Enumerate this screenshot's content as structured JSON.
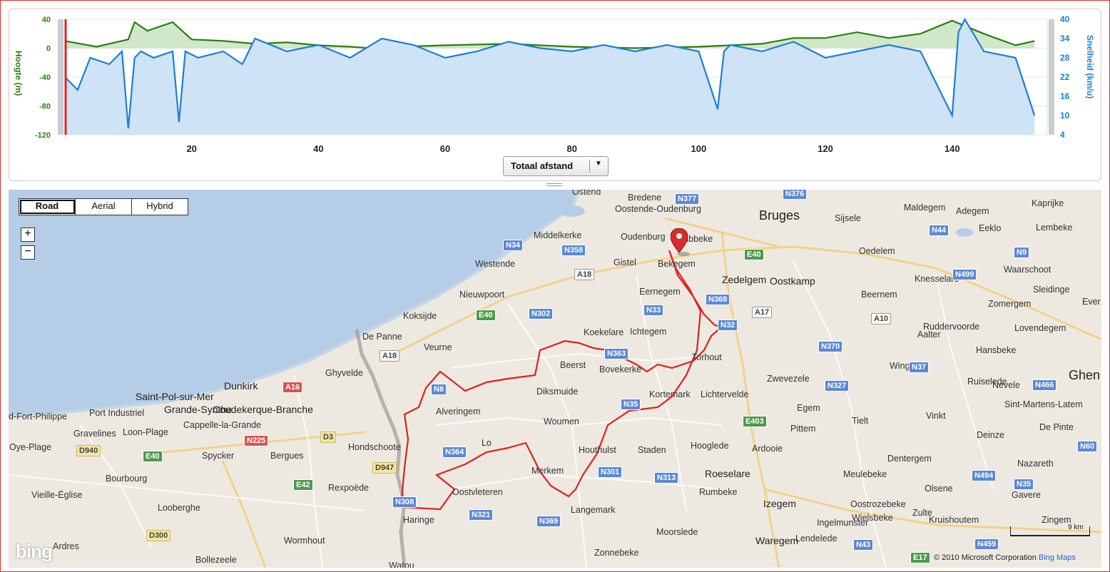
{
  "chart": {
    "left_axis_label": "Hoogte (m)",
    "right_axis_label": "Snelheid (km/u)",
    "left_ticks": [
      "40",
      "0",
      "-40",
      "-80",
      "-120"
    ],
    "right_ticks": [
      "40",
      "34",
      "28",
      "22",
      "16",
      "10",
      "4"
    ],
    "x_ticks": [
      "20",
      "40",
      "60",
      "80",
      "100",
      "120",
      "140"
    ],
    "distance_select": "Totaal afstand",
    "colors": {
      "altitude": "#2e7d10",
      "speed": "#1a7fd8",
      "cursor": "#e02020"
    }
  },
  "chart_data": [
    {
      "type": "area",
      "name": "Hoogte",
      "xlabel": "",
      "ylabel": "Hoogte (m)",
      "xlim": [
        0,
        155
      ],
      "ylim": [
        -120,
        40
      ],
      "x": [
        0,
        5,
        10,
        11,
        13,
        17,
        20,
        25,
        30,
        35,
        40,
        45,
        48,
        49,
        50,
        51,
        53,
        60,
        70,
        80,
        90,
        100,
        110,
        115,
        120,
        125,
        130,
        135,
        140,
        145,
        150,
        153
      ],
      "y": [
        10,
        2,
        12,
        36,
        24,
        36,
        12,
        10,
        6,
        8,
        4,
        2,
        0,
        -80,
        -108,
        -20,
        2,
        4,
        6,
        2,
        0,
        2,
        6,
        14,
        14,
        22,
        14,
        20,
        38,
        20,
        4,
        10
      ]
    },
    {
      "type": "line",
      "name": "Snelheid",
      "xlabel": "",
      "ylabel": "Snelheid (km/u)",
      "xlim": [
        0,
        155
      ],
      "ylim": [
        4,
        40
      ],
      "x": [
        0,
        2,
        4,
        7,
        9,
        10,
        11,
        12,
        14,
        17,
        18,
        19,
        21,
        25,
        28,
        30,
        35,
        40,
        45,
        50,
        55,
        60,
        65,
        70,
        75,
        80,
        85,
        90,
        95,
        100,
        103,
        104,
        105,
        110,
        115,
        120,
        125,
        130,
        135,
        140,
        141,
        142,
        145,
        150,
        153
      ],
      "y": [
        22,
        18,
        28,
        26,
        30,
        6,
        28,
        30,
        28,
        30,
        8,
        30,
        28,
        30,
        26,
        34,
        30,
        32,
        28,
        34,
        32,
        28,
        30,
        33,
        31,
        30,
        32,
        30,
        32,
        30,
        12,
        30,
        32,
        30,
        33,
        28,
        30,
        32,
        30,
        10,
        36,
        40,
        30,
        28,
        10
      ]
    }
  ],
  "map": {
    "tabs": [
      {
        "label": "Road",
        "active": true
      },
      {
        "label": "Aerial",
        "active": false
      },
      {
        "label": "Hybrid",
        "active": false
      }
    ],
    "zoom_in": "+",
    "zoom_out": "−",
    "places": [
      {
        "name": "Ostend",
        "cls": ""
      },
      {
        "name": "Bredene",
        "cls": ""
      },
      {
        "name": "Oostende-Oudenburg",
        "cls": ""
      },
      {
        "name": "Bruges",
        "cls": "city"
      },
      {
        "name": "Sijsele",
        "cls": ""
      },
      {
        "name": "Maldegem",
        "cls": ""
      },
      {
        "name": "Adegem",
        "cls": ""
      },
      {
        "name": "Kaprijke",
        "cls": ""
      },
      {
        "name": "Middelkerke",
        "cls": ""
      },
      {
        "name": "Oudenburg",
        "cls": ""
      },
      {
        "name": "Jabbeke",
        "cls": ""
      },
      {
        "name": "Eeklo",
        "cls": ""
      },
      {
        "name": "Lembeke",
        "cls": ""
      },
      {
        "name": "Oedelem",
        "cls": ""
      },
      {
        "name": "Westende",
        "cls": ""
      },
      {
        "name": "Gistel",
        "cls": ""
      },
      {
        "name": "Bekegem",
        "cls": ""
      },
      {
        "name": "Zedelgem",
        "cls": "town"
      },
      {
        "name": "Oostkamp",
        "cls": "town"
      },
      {
        "name": "Waarschoot",
        "cls": ""
      },
      {
        "name": "Knesselare",
        "cls": ""
      },
      {
        "name": "Nieuwpoort",
        "cls": ""
      },
      {
        "name": "Eernegem",
        "cls": ""
      },
      {
        "name": "Beernem",
        "cls": ""
      },
      {
        "name": "Sleidinge",
        "cls": ""
      },
      {
        "name": "Koksijde",
        "cls": ""
      },
      {
        "name": "Zomergem",
        "cls": ""
      },
      {
        "name": "Ever",
        "cls": ""
      },
      {
        "name": "Ichtegem",
        "cls": ""
      },
      {
        "name": "Ruddervoorde",
        "cls": ""
      },
      {
        "name": "Lovendegem",
        "cls": ""
      },
      {
        "name": "De Panne",
        "cls": ""
      },
      {
        "name": "Koekelare",
        "cls": ""
      },
      {
        "name": "Aalter",
        "cls": ""
      },
      {
        "name": "Veurne",
        "cls": ""
      },
      {
        "name": "Torhout",
        "cls": ""
      },
      {
        "name": "Hansbeke",
        "cls": ""
      },
      {
        "name": "Beerst",
        "cls": ""
      },
      {
        "name": "Wingene",
        "cls": ""
      },
      {
        "name": "Ghyvelde",
        "cls": ""
      },
      {
        "name": "Bovekerke",
        "cls": ""
      },
      {
        "name": "Zwevezele",
        "cls": ""
      },
      {
        "name": "Ruiselede",
        "cls": ""
      },
      {
        "name": "Ghen",
        "cls": "city"
      },
      {
        "name": "Dunkirk",
        "cls": "town"
      },
      {
        "name": "Saint-Pol-sur-Mer",
        "cls": "town"
      },
      {
        "name": "Diksmuide",
        "cls": ""
      },
      {
        "name": "Kortemark",
        "cls": ""
      },
      {
        "name": "Lichtervelde",
        "cls": ""
      },
      {
        "name": "Nevele",
        "cls": ""
      },
      {
        "name": "Grande-Synthe",
        "cls": "town"
      },
      {
        "name": "Coudekerque-Branche",
        "cls": "town"
      },
      {
        "name": "Alveringem",
        "cls": ""
      },
      {
        "name": "Egem",
        "cls": ""
      },
      {
        "name": "Sint-Martens-Latem",
        "cls": ""
      },
      {
        "name": "d-Fort-Philippe",
        "cls": ""
      },
      {
        "name": "Port Industriel",
        "cls": ""
      },
      {
        "name": "Vinkt",
        "cls": ""
      },
      {
        "name": "Cappelle-la-Grande",
        "cls": ""
      },
      {
        "name": "Woumen",
        "cls": ""
      },
      {
        "name": "Pittem",
        "cls": ""
      },
      {
        "name": "Tielt",
        "cls": ""
      },
      {
        "name": "Gravelines",
        "cls": ""
      },
      {
        "name": "Loon-Plage",
        "cls": ""
      },
      {
        "name": "De Pinte",
        "cls": ""
      },
      {
        "name": "Deinze",
        "cls": ""
      },
      {
        "name": "Oye-Plage",
        "cls": ""
      },
      {
        "name": "Hondschoote",
        "cls": ""
      },
      {
        "name": "Lo",
        "cls": ""
      },
      {
        "name": "Houthulst",
        "cls": ""
      },
      {
        "name": "Staden",
        "cls": ""
      },
      {
        "name": "Hooglede",
        "cls": ""
      },
      {
        "name": "Ardooie",
        "cls": ""
      },
      {
        "name": "Spycker",
        "cls": ""
      },
      {
        "name": "Bergues",
        "cls": ""
      },
      {
        "name": "Dentergem",
        "cls": ""
      },
      {
        "name": "Nazareth",
        "cls": ""
      },
      {
        "name": "Merkem",
        "cls": ""
      },
      {
        "name": "Roeselare",
        "cls": "town"
      },
      {
        "name": "Meulebeke",
        "cls": ""
      },
      {
        "name": "Bourbourg",
        "cls": ""
      },
      {
        "name": "Rexpoëde",
        "cls": ""
      },
      {
        "name": "Oostvleteren",
        "cls": ""
      },
      {
        "name": "Rumbeke",
        "cls": ""
      },
      {
        "name": "Olsene",
        "cls": ""
      },
      {
        "name": "Vieille-Église",
        "cls": ""
      },
      {
        "name": "Gavere",
        "cls": ""
      },
      {
        "name": "Izegem",
        "cls": "town"
      },
      {
        "name": "Oostrozebeke",
        "cls": ""
      },
      {
        "name": "Zulte",
        "cls": ""
      },
      {
        "name": "Looberghe",
        "cls": ""
      },
      {
        "name": "Langemark",
        "cls": ""
      },
      {
        "name": "Haringe",
        "cls": ""
      },
      {
        "name": "Ingelmunster",
        "cls": ""
      },
      {
        "name": "Wielsbeke",
        "cls": ""
      },
      {
        "name": "Kruishoutem",
        "cls": ""
      },
      {
        "name": "Zingem",
        "cls": ""
      },
      {
        "name": "Moorslede",
        "cls": ""
      },
      {
        "name": "Lendelede",
        "cls": ""
      },
      {
        "name": "Wormhout",
        "cls": ""
      },
      {
        "name": "Waregem",
        "cls": "town"
      },
      {
        "name": "Ardres",
        "cls": ""
      },
      {
        "name": "Zonnebeke",
        "cls": ""
      },
      {
        "name": "Bollezeele",
        "cls": ""
      },
      {
        "name": "Watou",
        "cls": ""
      }
    ],
    "roads": [
      {
        "label": "N377",
        "cls": ""
      },
      {
        "label": "N376",
        "cls": ""
      },
      {
        "label": "N34",
        "cls": ""
      },
      {
        "label": "N358",
        "cls": ""
      },
      {
        "label": "N44",
        "cls": ""
      },
      {
        "label": "N9",
        "cls": ""
      },
      {
        "label": "E40",
        "cls": "green"
      },
      {
        "label": "A18",
        "cls": "white"
      },
      {
        "label": "N499",
        "cls": ""
      },
      {
        "label": "N368",
        "cls": ""
      },
      {
        "label": "N33",
        "cls": ""
      },
      {
        "label": "A17",
        "cls": "white"
      },
      {
        "label": "A10",
        "cls": "white"
      },
      {
        "label": "E40",
        "cls": "green"
      },
      {
        "label": "N302",
        "cls": ""
      },
      {
        "label": "N32",
        "cls": ""
      },
      {
        "label": "N363",
        "cls": ""
      },
      {
        "label": "N370",
        "cls": ""
      },
      {
        "label": "A18",
        "cls": "white"
      },
      {
        "label": "N37",
        "cls": ""
      },
      {
        "label": "N8",
        "cls": ""
      },
      {
        "label": "A16",
        "cls": "red"
      },
      {
        "label": "N327",
        "cls": ""
      },
      {
        "label": "N466",
        "cls": ""
      },
      {
        "label": "N35",
        "cls": ""
      },
      {
        "label": "E403",
        "cls": "green"
      },
      {
        "label": "N225",
        "cls": "red"
      },
      {
        "label": "D3",
        "cls": "yellow"
      },
      {
        "label": "D940",
        "cls": "yellow"
      },
      {
        "label": "E40",
        "cls": "green"
      },
      {
        "label": "N364",
        "cls": ""
      },
      {
        "label": "N60",
        "cls": ""
      },
      {
        "label": "D947",
        "cls": "yellow"
      },
      {
        "label": "N301",
        "cls": ""
      },
      {
        "label": "N313",
        "cls": ""
      },
      {
        "label": "N494",
        "cls": ""
      },
      {
        "label": "E42",
        "cls": "green"
      },
      {
        "label": "N35",
        "cls": ""
      },
      {
        "label": "N308",
        "cls": ""
      },
      {
        "label": "N321",
        "cls": ""
      },
      {
        "label": "N369",
        "cls": ""
      },
      {
        "label": "D300",
        "cls": "yellow"
      },
      {
        "label": "N43",
        "cls": ""
      },
      {
        "label": "N459",
        "cls": ""
      },
      {
        "label": "E17",
        "cls": "green"
      }
    ],
    "scale_label": "9 km",
    "bing_logo": "bing",
    "copyright": "© 2010 Microsoft Corporation",
    "copyright_link": "Bing Maps"
  }
}
